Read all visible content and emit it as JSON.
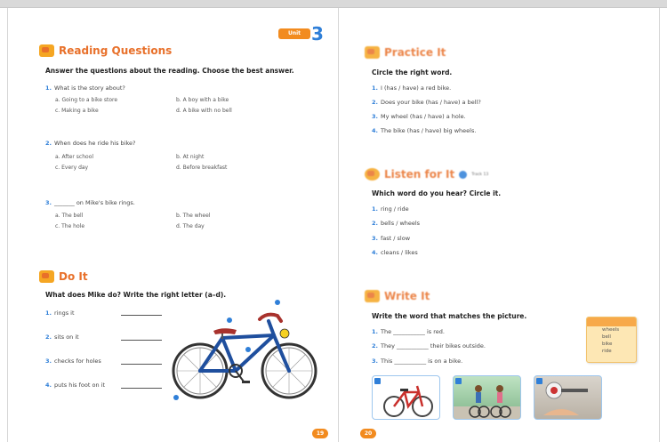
{
  "unit": {
    "label": "Unit",
    "number": "3"
  },
  "left": {
    "reading": {
      "title": "Reading Questions",
      "instruction": "Answer the questions about the reading. Choose the best answer.",
      "questions": [
        {
          "num": "1.",
          "text": "What is the story about?",
          "options": [
            "a. Going to a bike store",
            "b. A boy with a bike",
            "c. Making a bike",
            "d. A bike with no bell"
          ]
        },
        {
          "num": "2.",
          "text": "When does he ride his bike?",
          "options": [
            "a. After school",
            "b. At night",
            "c. Every day",
            "d. Before breakfast"
          ]
        },
        {
          "num": "3.",
          "text": "_______ on Mike's bike rings.",
          "options": [
            "a. The bell",
            "b. The wheel",
            "c. The hole",
            "d. The day"
          ]
        }
      ]
    },
    "doit": {
      "title": "Do It",
      "instruction": "What does Mike do? Write the right letter (a–d).",
      "items": [
        {
          "num": "1.",
          "text": "rings it"
        },
        {
          "num": "2.",
          "text": "sits on it"
        },
        {
          "num": "3.",
          "text": "checks for holes"
        },
        {
          "num": "4.",
          "text": "puts his foot on it"
        }
      ]
    },
    "page_number": "19"
  },
  "right": {
    "practice": {
      "title": "Practice It",
      "instruction": "Circle the right word.",
      "items": [
        {
          "num": "1.",
          "text": "I (has / have) a red bike."
        },
        {
          "num": "2.",
          "text": "Does your bike (has / have) a bell?"
        },
        {
          "num": "3.",
          "text": "My wheel (has / have) a hole."
        },
        {
          "num": "4.",
          "text": "The bike (has / have) big wheels."
        }
      ]
    },
    "listen": {
      "title": "Listen for It",
      "track": "Track 13",
      "instruction": "Which word do you hear? Circle it.",
      "items": [
        {
          "num": "1.",
          "text": "ring / ride"
        },
        {
          "num": "2.",
          "text": "bells / wheels"
        },
        {
          "num": "3.",
          "text": "fast / slow"
        },
        {
          "num": "4.",
          "text": "cleans / likes"
        }
      ]
    },
    "write": {
      "title": "Write It",
      "instruction": "Write the word that matches the picture.",
      "items": [
        {
          "num": "1.",
          "text": "The ___________ is red."
        },
        {
          "num": "2.",
          "text": "They ___________ their bikes outside."
        },
        {
          "num": "3.",
          "text": "This ___________ is on a bike."
        }
      ],
      "word_box": [
        "wheels",
        "bell",
        "bike",
        "ride"
      ]
    },
    "page_number": "20"
  },
  "colors": {
    "accent_orange": "#e8702a",
    "number_blue": "#2f7fd8",
    "bike_blue": "#1f4f9e"
  }
}
